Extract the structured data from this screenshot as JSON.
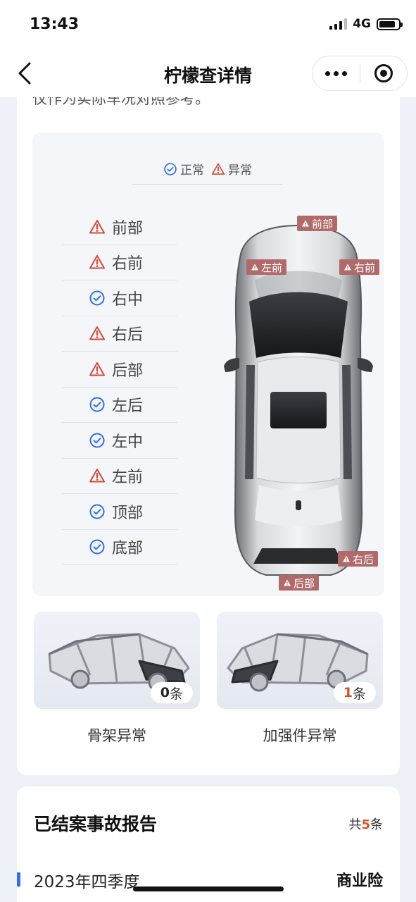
{
  "status_bar": {
    "time": "13:43",
    "network": "4G",
    "battery_level": 0.85
  },
  "nav": {
    "title": "柠檬查详情",
    "back_icon": "chevron-left-icon",
    "more_icon": "more-dots-icon",
    "target_icon": "target-icon"
  },
  "intro_note": "仅作为实际车况对照参考。",
  "legend": {
    "normal": "正常",
    "abnormal": "异常"
  },
  "parts": [
    {
      "label": "前部",
      "status": "abnormal"
    },
    {
      "label": "右前",
      "status": "abnormal"
    },
    {
      "label": "右中",
      "status": "normal"
    },
    {
      "label": "右后",
      "status": "abnormal"
    },
    {
      "label": "后部",
      "status": "abnormal"
    },
    {
      "label": "左后",
      "status": "normal"
    },
    {
      "label": "左中",
      "status": "normal"
    },
    {
      "label": "左前",
      "status": "abnormal"
    },
    {
      "label": "顶部",
      "status": "normal"
    },
    {
      "label": "底部",
      "status": "normal"
    }
  ],
  "car_tags": {
    "front": "前部",
    "left_front": "左前",
    "right_front": "右前",
    "right_rear": "右后",
    "rear": "后部"
  },
  "frames": [
    {
      "label": "骨架异常",
      "count": "0",
      "unit": "条",
      "count_color": "#222222"
    },
    {
      "label": "加强件异常",
      "count": "1",
      "unit": "条",
      "count_color": "#d9532c"
    }
  ],
  "report": {
    "title": "已结案事故报告",
    "total_prefix": "共",
    "total_count": "5",
    "total_suffix": "条",
    "quarter": "2023年四季度",
    "insurance_type": "商业险"
  },
  "colors": {
    "normal": "#2f6fe0",
    "abnormal": "#d24a3a",
    "tag_bg": "#b06a6a",
    "accent": "#d9532c"
  }
}
